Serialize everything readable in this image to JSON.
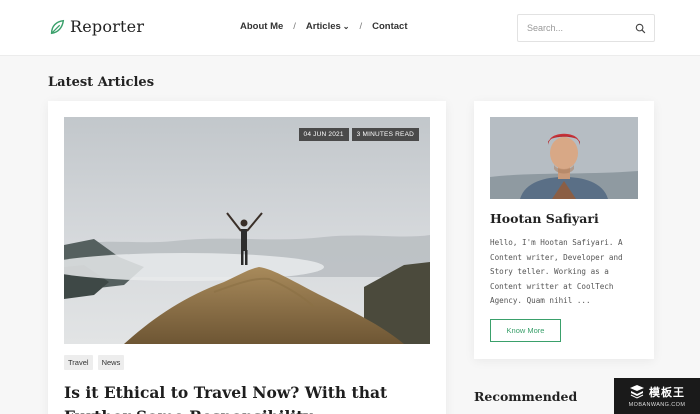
{
  "header": {
    "logo_text": "Reporter",
    "nav": [
      {
        "label": "About Me"
      },
      {
        "label": "Articles"
      },
      {
        "label": "Contact"
      }
    ],
    "nav_separator": "/",
    "search_placeholder": "Search..."
  },
  "main": {
    "section_title": "Latest Articles",
    "article": {
      "date": "04 JUN 2021",
      "read_time": "3 MINUTES READ",
      "tags": [
        "Travel",
        "News"
      ],
      "title": "Is it Ethical to Travel Now? With that Further Some Responsibility"
    }
  },
  "sidebar": {
    "author_name": "Hootan Safiyari",
    "author_bio": "Hello, I'm Hootan Safiyari. A Content writer, Developer and Story teller. Working as a Content writter at CoolTech Agency. Quam nihil ...",
    "know_more_label": "Know More",
    "recommended_title": "Recommended"
  },
  "watermark": {
    "brand": "模板王",
    "url": "MOBANWANG.COM"
  },
  "colors": {
    "accent": "#3aa06b",
    "background": "#f7f7f7",
    "meta_badge": "#4a4a4a"
  },
  "icons": [
    "leaf-logo-icon",
    "chevron-down-icon",
    "search-icon"
  ]
}
